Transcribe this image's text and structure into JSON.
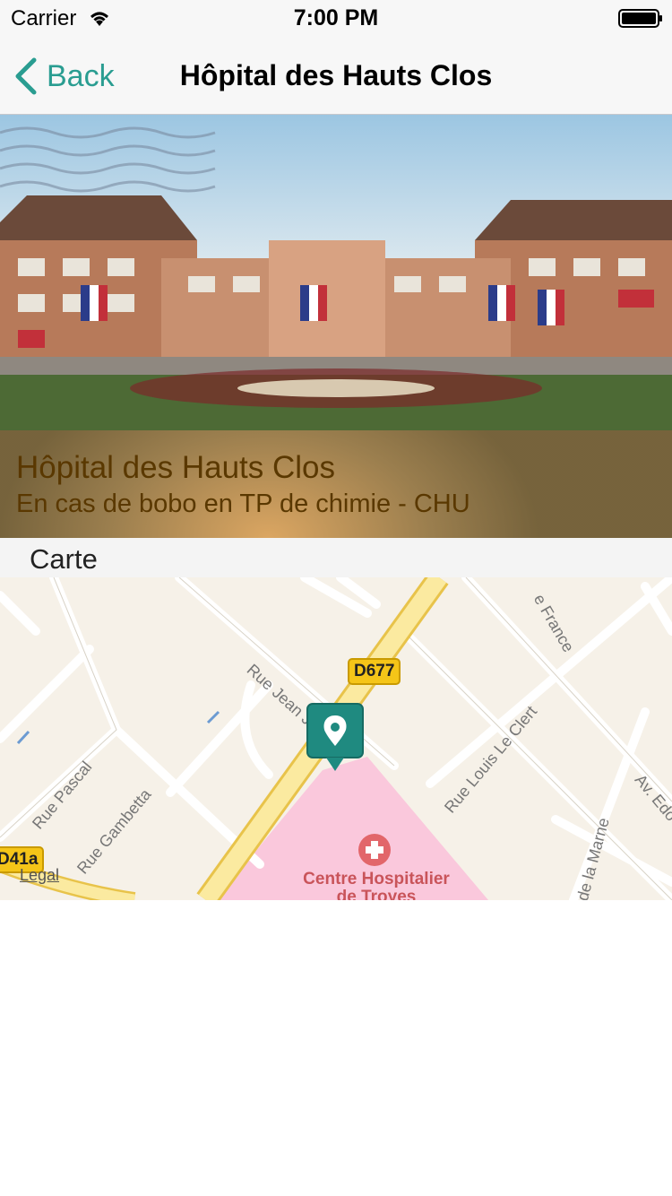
{
  "status_bar": {
    "carrier": "Carrier",
    "time": "7:00 PM",
    "wifi_icon": "wifi-icon",
    "battery_icon": "battery-icon"
  },
  "nav": {
    "back_label": "Back",
    "title": "Hôpital des Hauts Clos",
    "back_icon": "chevron-left-icon",
    "accent_color": "#2a9d91"
  },
  "hero": {
    "title": "Hôpital des Hauts Clos",
    "subtitle": "En cas de bobo en TP de chimie - CHU",
    "text_color": "#5a3800"
  },
  "section": {
    "label": "Carte"
  },
  "map": {
    "legal": "Legal",
    "road_badges": [
      "D677",
      "D41a"
    ],
    "streets": [
      "Rue Jean J",
      "Rue Pascal",
      "Rue Gambetta",
      "Rue Louis Le Clert",
      "Av. Edo",
      "de la Marne",
      "e France"
    ],
    "poi_name_line1": "Centre Hospitalier",
    "poi_name_line2": "de Troyes",
    "poi_icon": "hospital-cross-icon",
    "pin_icon": "location-pin-icon",
    "hospital_area_color": "#fac8dc"
  }
}
